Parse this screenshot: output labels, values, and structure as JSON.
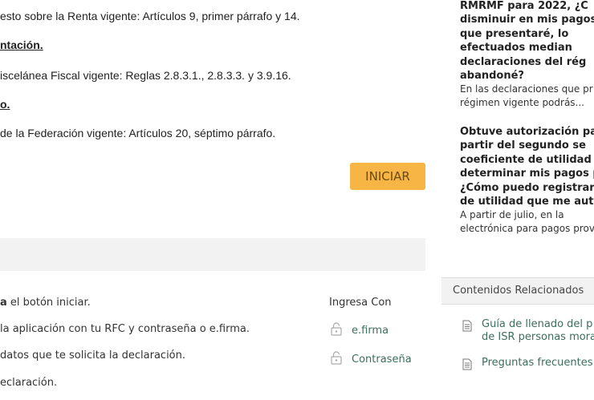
{
  "legal": {
    "isr_line": "esto sobre la Renta vigente: Artículos 9, primer párrafo y 14.",
    "section1_heading": "ntación.",
    "misc_line": "iscelánea Fiscal vigente: Reglas 2.8.3.1., 2.8.3.3. y 3.9.16.",
    "section2_heading": "o.",
    "cff_line": " de la Federación vigente: Artículos 20, séptimo párrafo."
  },
  "actions": {
    "start_label": "INICIAR"
  },
  "steps": {
    "step1_bold": "a",
    "step1_rest": " el botón iniciar.",
    "step2": " la aplicación con tu RFC y contraseña o e.firma.",
    "step3": "datos que te solicita la declaración.",
    "step4": "eclaración."
  },
  "login": {
    "title": "Ingresa Con",
    "options": [
      {
        "label": "e.firma",
        "icon": "unlock-icon"
      },
      {
        "label": "Contraseña",
        "icon": "unlock-icon"
      }
    ]
  },
  "faq": {
    "q1_lines": [
      "RMRMF para 2022, ¿C",
      "disminuir en mis pagos p",
      "que    presentaré,    lo",
      "efectuados        median",
      "declaraciones   del   rég",
      "abandoné?"
    ],
    "a1_lines": [
      "En las declaraciones que pr",
      "régimen vigente podrás..."
    ],
    "q2_lines": [
      "Obtuve autorización par",
      "partir  del  segundo  se",
      "coeficiente  de  utilidad",
      "determinar mis pagos p",
      "¿Cómo puedo registrar e",
      "de utilidad que me autori"
    ],
    "a2_lines": [
      "A  partir  de  julio,  en  la",
      "electrónica para pagos prov"
    ]
  },
  "related": {
    "title": "Contenidos Relacionados",
    "links": [
      {
        "lines": [
          "Guía de llenado del p",
          "de ISR personas moral"
        ],
        "icon": "document-icon"
      },
      {
        "lines": [
          "Preguntas frecuentes"
        ],
        "icon": "document-icon"
      }
    ]
  },
  "colors": {
    "accent": "#f6b544",
    "link": "#3c6e5e",
    "band": "#f2f2f2"
  }
}
